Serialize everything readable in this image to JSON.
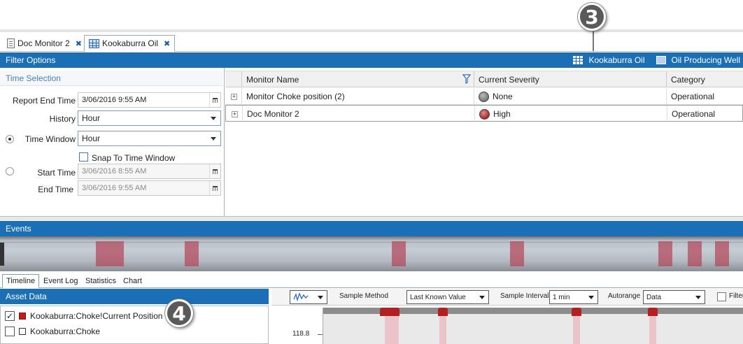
{
  "tabs": [
    {
      "label": "Doc Monitor 2",
      "active": false
    },
    {
      "label": "Kookaburra Oil",
      "active": true
    }
  ],
  "callouts": [
    "3",
    "4"
  ],
  "filter_bar": {
    "title": "Filter Options",
    "asset_label": "Kookaburra Oil",
    "asset_type_label": "Oil Producing Well"
  },
  "time_selection": {
    "title": "Time Selection",
    "report_end_time_label": "Report End Time",
    "report_end_time_value": "3/06/2016 9:55 AM",
    "history_label": "History",
    "history_value": "Hour",
    "time_window_label": "Time Window",
    "time_window_value": "Hour",
    "snap_label": "Snap To Time Window",
    "start_time_label": "Start Time",
    "start_time_value": "3/06/2016 8:55 AM",
    "end_time_label": "End Time",
    "end_time_value": "3/06/2016 9:55 AM"
  },
  "monitor_grid": {
    "columns": [
      "Monitor Name",
      "Current Severity",
      "Category"
    ],
    "rows": [
      {
        "name": "Monitor Choke position (2)",
        "severity": "None",
        "severity_color": "#7a7a7a",
        "category": "Operational"
      },
      {
        "name": "Doc Monitor 2",
        "severity": "High",
        "severity_color": "#b83434",
        "category": "Operational"
      }
    ]
  },
  "events": {
    "title": "Events",
    "event_color": "#b4465a"
  },
  "sub_tabs": [
    "Timeline",
    "Event Log",
    "Statistics",
    "Chart"
  ],
  "asset_data": {
    "title": "Asset Data",
    "items": [
      {
        "label": "Kookaburra:Choke!Current Position",
        "checked": true,
        "swatch": "#e01010"
      },
      {
        "label": "Kookaburra:Choke",
        "checked": false,
        "swatch": "#ffffff"
      }
    ]
  },
  "chart_toolbar": {
    "sample_method_label": "Sample Method",
    "sample_method_value": "Last Known Value",
    "sample_interval_label": "Sample Interval",
    "sample_interval_value": "1 min",
    "autorange_label": "Autorange",
    "autorange_value": "Data",
    "filter_label": "Filter"
  },
  "chart": {
    "y_tick": "118.8",
    "series_color": "#b32020"
  }
}
